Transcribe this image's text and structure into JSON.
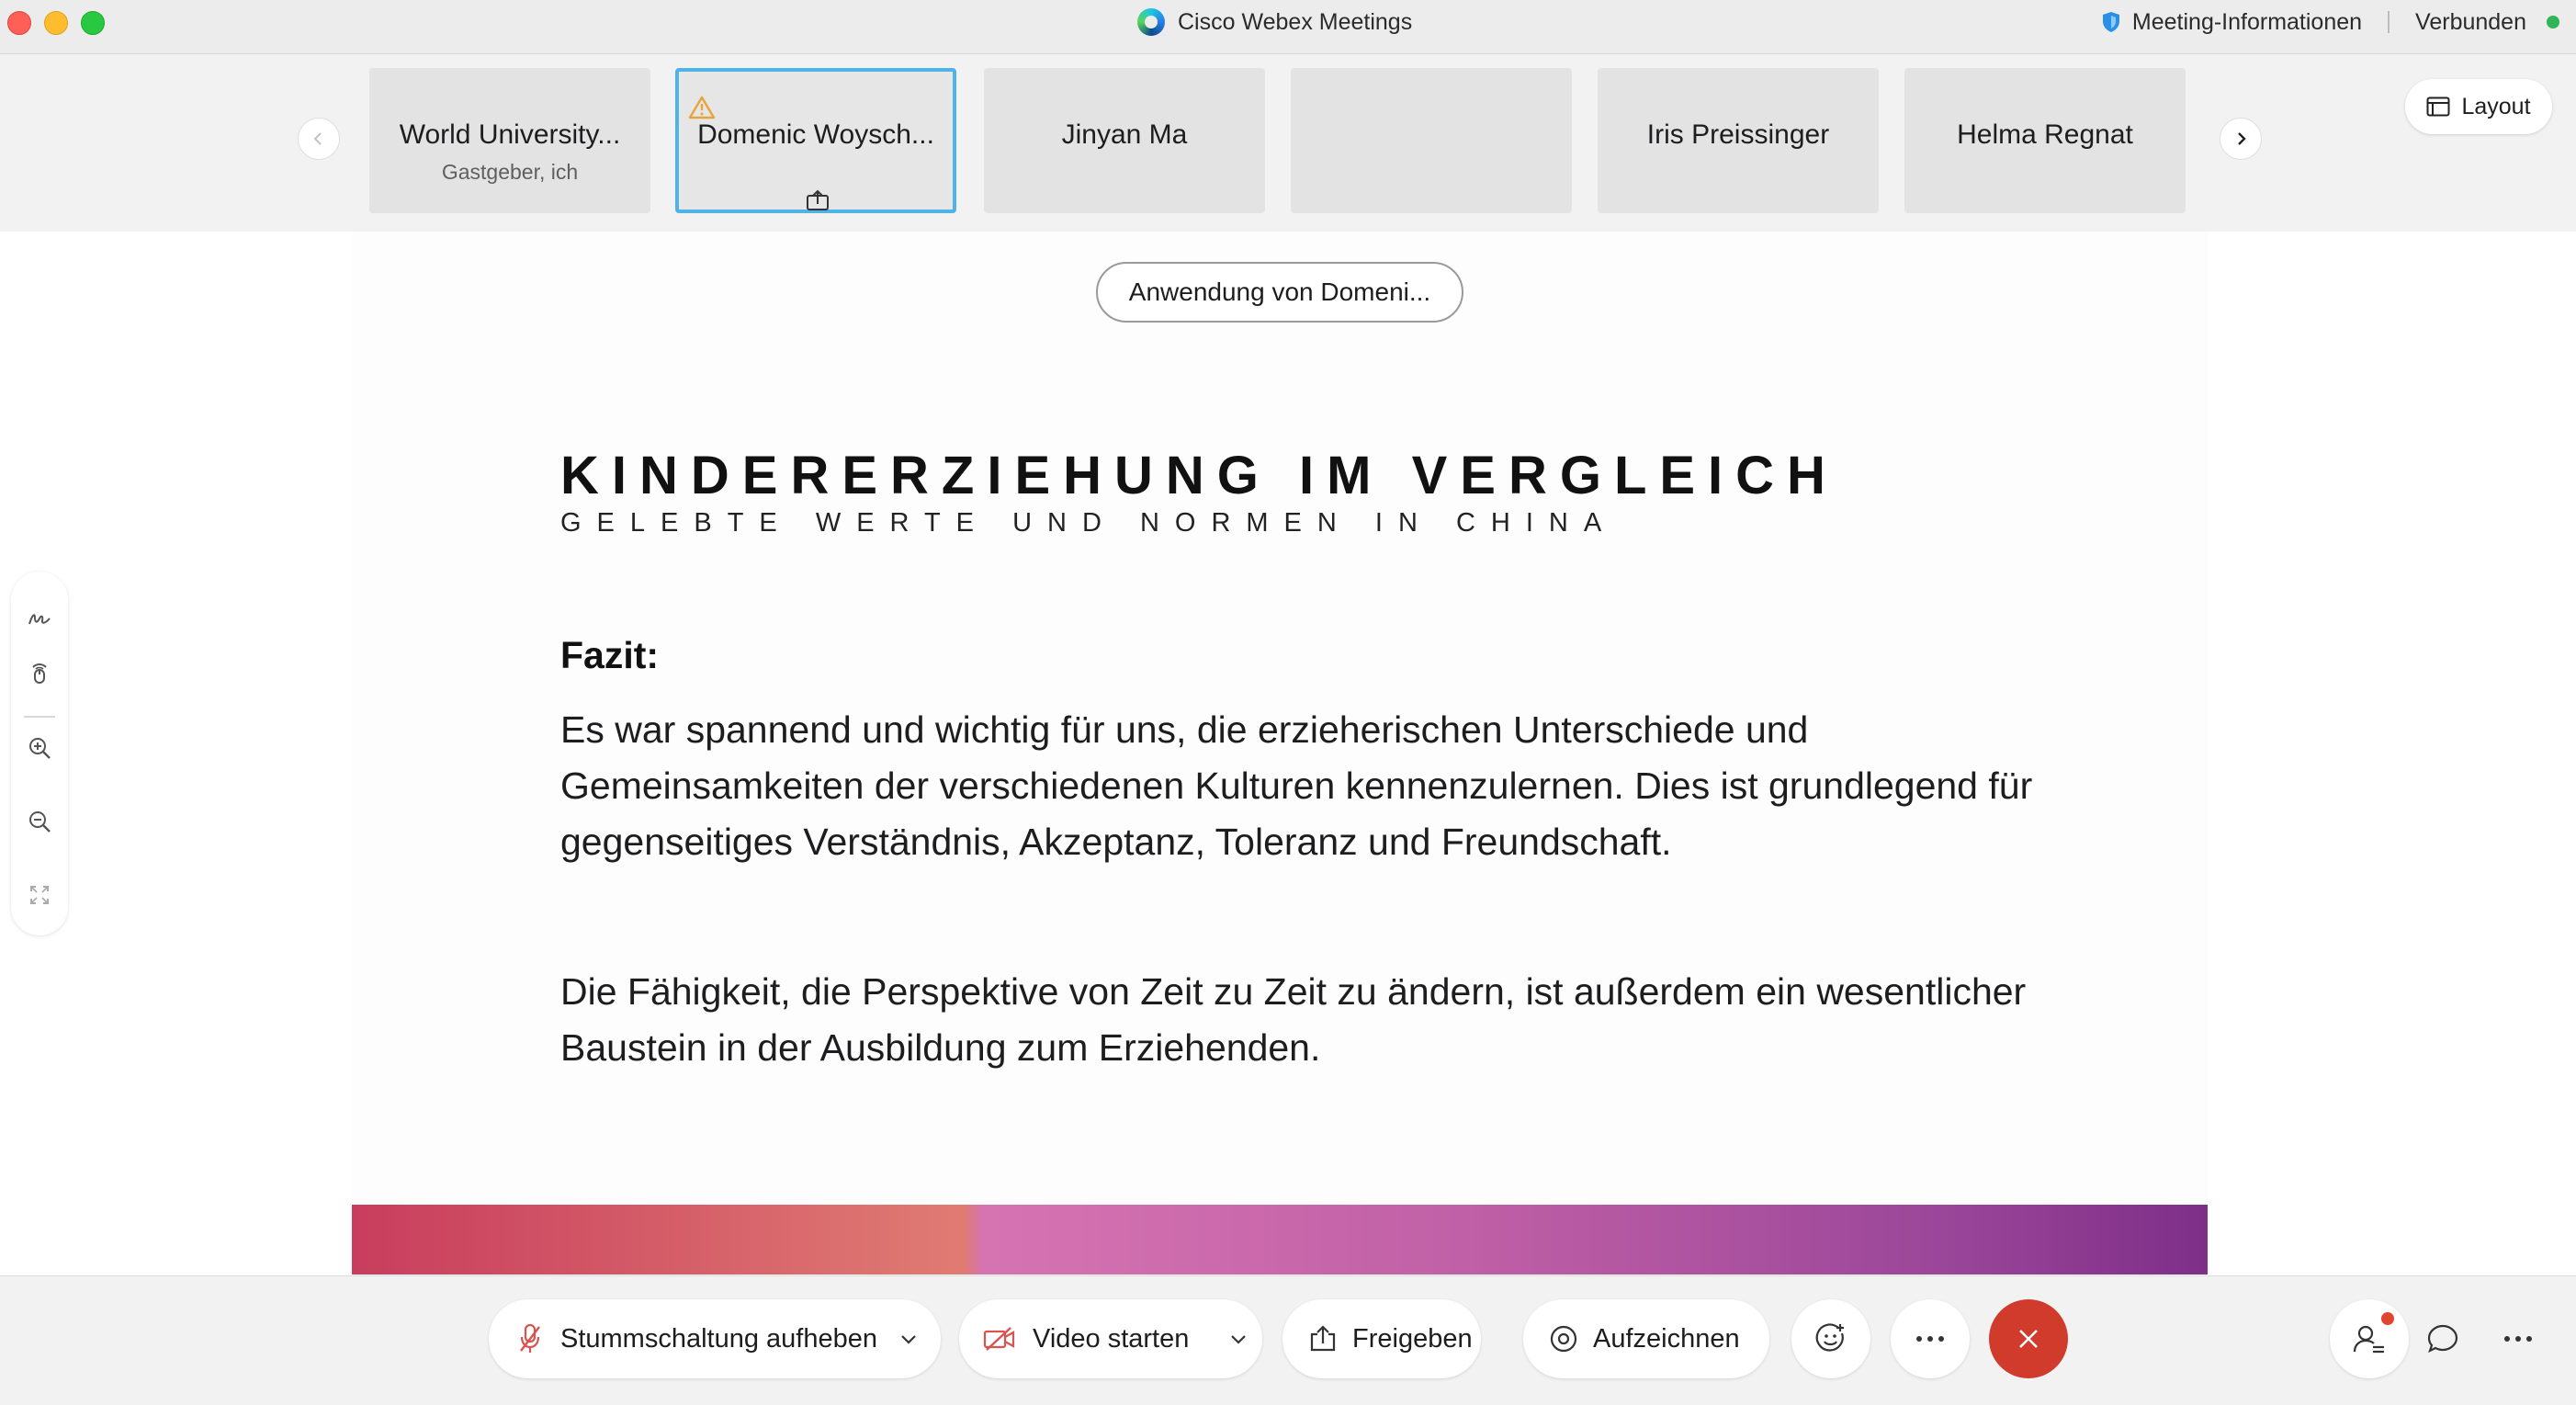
{
  "window": {
    "title": "Cisco Webex Meetings",
    "meeting_info": "Meeting-Informationen",
    "status": "Verbunden"
  },
  "participants": [
    {
      "name": "World University...",
      "role": "Gastgeber, ich"
    },
    {
      "name": "Domenic Woysch...",
      "role": ""
    },
    {
      "name": "Jinyan Ma",
      "role": ""
    },
    {
      "name": "",
      "role": ""
    },
    {
      "name": "Iris Preissinger",
      "role": ""
    },
    {
      "name": "Helma Regnat",
      "role": ""
    }
  ],
  "layout_label": "Layout",
  "share": {
    "pill_label": "Anwendung von Domeni..."
  },
  "slide": {
    "title": "KINDERERZIEHUNG IM VERGLEICH",
    "subtitle": "GELEBTE WERTE UND NORMEN IN CHINA",
    "heading": "Fazit:",
    "paragraph1_line1": "Es war spannend und wichtig für uns, die erzieherischen Unterschiede und",
    "paragraph1_line2": "Gemeinsamkeiten der verschiedenen Kulturen kennenzulernen. Dies ist grundlegend für",
    "paragraph1_line3": "gegenseitiges Verständnis, Akzeptanz, Toleranz und Freundschaft.",
    "paragraph2_line1": "Die Fähigkeit, die Perspektive von Zeit zu Zeit zu ändern, ist außerdem ein wesentlicher",
    "paragraph2_line2": "Baustein in der Ausbildung zum Erziehenden."
  },
  "controls": {
    "unmute": "Stummschaltung aufheben",
    "video": "Video starten",
    "share": "Freigeben",
    "record": "Aufzeichnen"
  },
  "colors": {
    "end_call": "#d03b2b",
    "active_border": "#4fb3e6",
    "status_green": "#2fb457"
  }
}
